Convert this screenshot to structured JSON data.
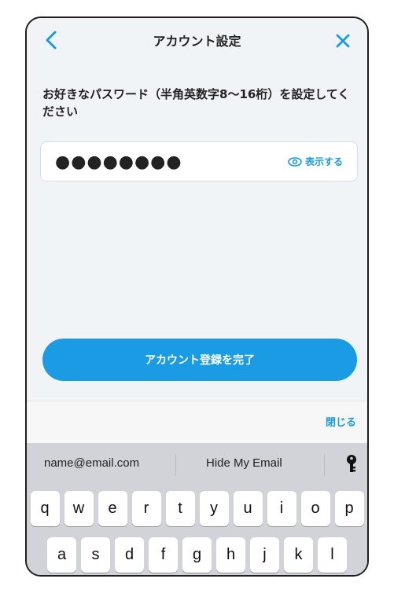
{
  "header": {
    "title": "アカウント設定"
  },
  "prompt": "お好きなパスワード（半角英数字8〜16桁）を設定してください",
  "password": {
    "masked_value": "●●●●●●●●",
    "show_label": "表示する"
  },
  "primary_button": "アカウント登録を完了",
  "accessory": {
    "done_label": "閉じる"
  },
  "keyboard": {
    "suggestions": [
      "name@email.com",
      "Hide My Email"
    ],
    "row1": [
      "q",
      "w",
      "e",
      "r",
      "t",
      "y",
      "u",
      "i",
      "o",
      "p"
    ],
    "row2": [
      "a",
      "s",
      "d",
      "f",
      "g",
      "h",
      "j",
      "k",
      "l"
    ]
  },
  "colors": {
    "accent": "#1b9be3",
    "background": "#f1f4f7",
    "keyboard": "#d1d3d8"
  }
}
